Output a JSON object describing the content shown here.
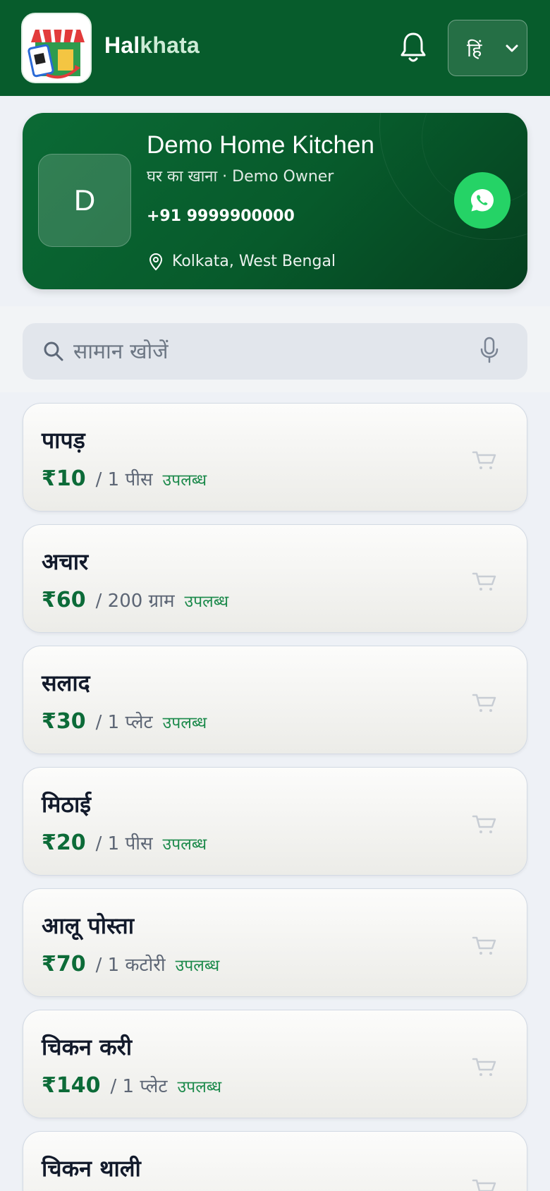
{
  "header": {
    "app_name_a": "Hal",
    "app_name_b": "khata",
    "language": "हिं"
  },
  "profile": {
    "initial": "D",
    "name": "Demo Home Kitchen",
    "subtitle": "घर का खाना · Demo Owner",
    "phone": "+91 9999900000",
    "location": "Kolkata, West Bengal"
  },
  "search": {
    "placeholder": "सामान खोजें"
  },
  "items": [
    {
      "name": "पापड़",
      "price": "₹10",
      "unit": "/ 1 पीस",
      "status": "उपलब्ध"
    },
    {
      "name": "अचार",
      "price": "₹60",
      "unit": "/ 200 ग्राम",
      "status": "उपलब्ध"
    },
    {
      "name": "सलाद",
      "price": "₹30",
      "unit": "/ 1 प्लेट",
      "status": "उपलब्ध"
    },
    {
      "name": "मिठाई",
      "price": "₹20",
      "unit": "/ 1 पीस",
      "status": "उपलब्ध"
    },
    {
      "name": "आलू पोस्ता",
      "price": "₹70",
      "unit": "/ 1 कटोरी",
      "status": "उपलब्ध"
    },
    {
      "name": "चिकन करी",
      "price": "₹140",
      "unit": "/ 1 प्लेट",
      "status": "उपलब्ध"
    },
    {
      "name": "चिकन थाली",
      "price": "",
      "unit": "",
      "status": ""
    }
  ],
  "colors": {
    "header_bg": "#075c2c",
    "accent_price": "#0c6b38",
    "whatsapp": "#25d366"
  }
}
